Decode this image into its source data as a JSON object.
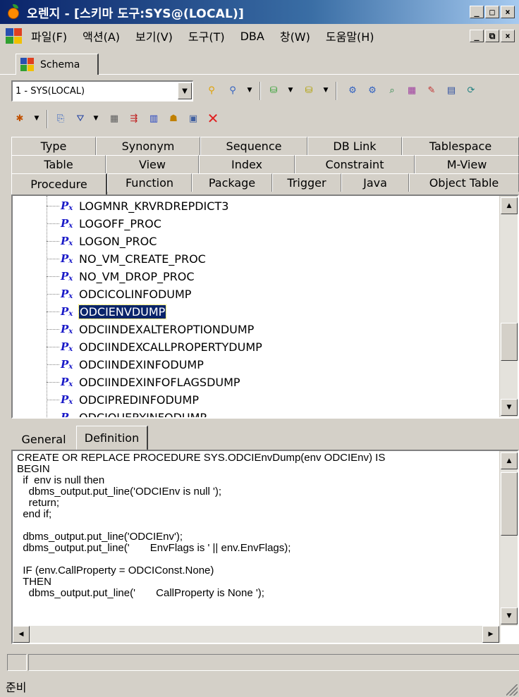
{
  "window": {
    "title": "오렌지 - [스키마 도구:SYS@(LOCAL)]",
    "min": "_",
    "max": "□",
    "close": "×"
  },
  "menubar": {
    "items": [
      "파일(F)",
      "액션(A)",
      "보기(V)",
      "도구(T)",
      "DBA",
      "창(W)",
      "도움말(H)"
    ],
    "doc_min": "_",
    "doc_restore": "⧉",
    "doc_close": "×"
  },
  "schema_tab": {
    "label": "Schema"
  },
  "schema_select": {
    "value": "1 - SYS(LOCAL)"
  },
  "object_tabs": {
    "row1": [
      "Type",
      "Synonym",
      "Sequence",
      "DB Link",
      "Tablespace"
    ],
    "row2": [
      "Table",
      "View",
      "Index",
      "Constraint",
      "M-View"
    ],
    "row3": [
      "Procedure",
      "Function",
      "Package",
      "Trigger",
      "Java",
      "Object Table"
    ],
    "active": "Procedure"
  },
  "tree": {
    "items": [
      "LOGMNR_KRVRDREPDICT3",
      "LOGOFF_PROC",
      "LOGON_PROC",
      "NO_VM_CREATE_PROC",
      "NO_VM_DROP_PROC",
      "ODCICOLINFODUMP",
      "ODCIENVDUMP",
      "ODCIINDEXALTEROPTIONDUMP",
      "ODCIINDEXCALLPROPERTYDUMP",
      "ODCIINDEXINFODUMP",
      "ODCIINDEXINFOFLAGSDUMP",
      "ODCIPREDINFODUMP",
      "ODCIQUERYINFODUMP"
    ],
    "selected": "ODCIENVDUMP"
  },
  "detail_tabs": {
    "general": "General",
    "definition": "Definition"
  },
  "code": {
    "text": "CREATE OR REPLACE PROCEDURE SYS.ODCIEnvDump(env ODCIEnv) IS\nBEGIN\n  if  env is null then\n    dbms_output.put_line('ODCIEnv is null ');\n    return;\n  end if;\n\n  dbms_output.put_line('ODCIEnv');\n  dbms_output.put_line('       EnvFlags is ' || env.EnvFlags);\n\n  IF (env.CallProperty = ODCIConst.None)\n  THEN\n    dbms_output.put_line('       CallProperty is None ');"
  },
  "statusbar": {
    "text": "준비"
  }
}
